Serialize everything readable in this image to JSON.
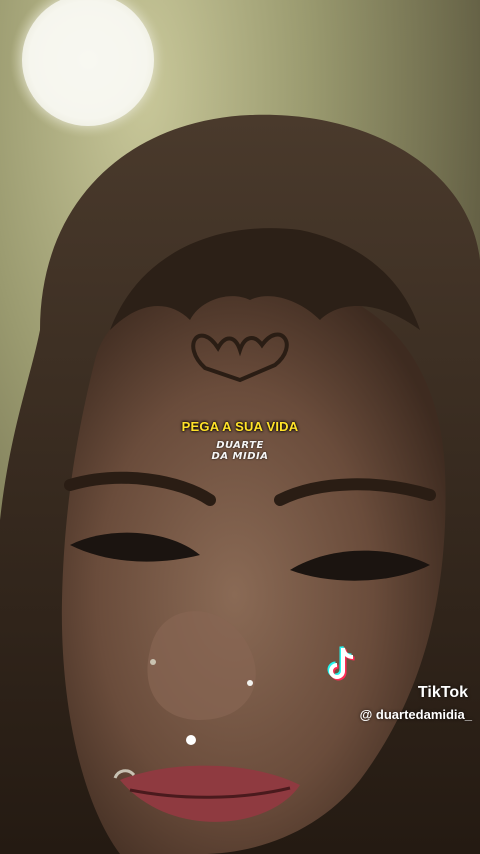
{
  "caption": "PEGA A SUA VIDA",
  "watermark": {
    "line1": "DUARTE",
    "line2": "DA MIDIA"
  },
  "branding": {
    "app": "TikTok",
    "handle": "@ duartedamidia_",
    "logo_icon": "tiktok-note-icon"
  },
  "colors": {
    "caption": "#ffe229",
    "tiktok_cyan": "#25f4ee",
    "tiktok_red": "#fe2c55"
  }
}
